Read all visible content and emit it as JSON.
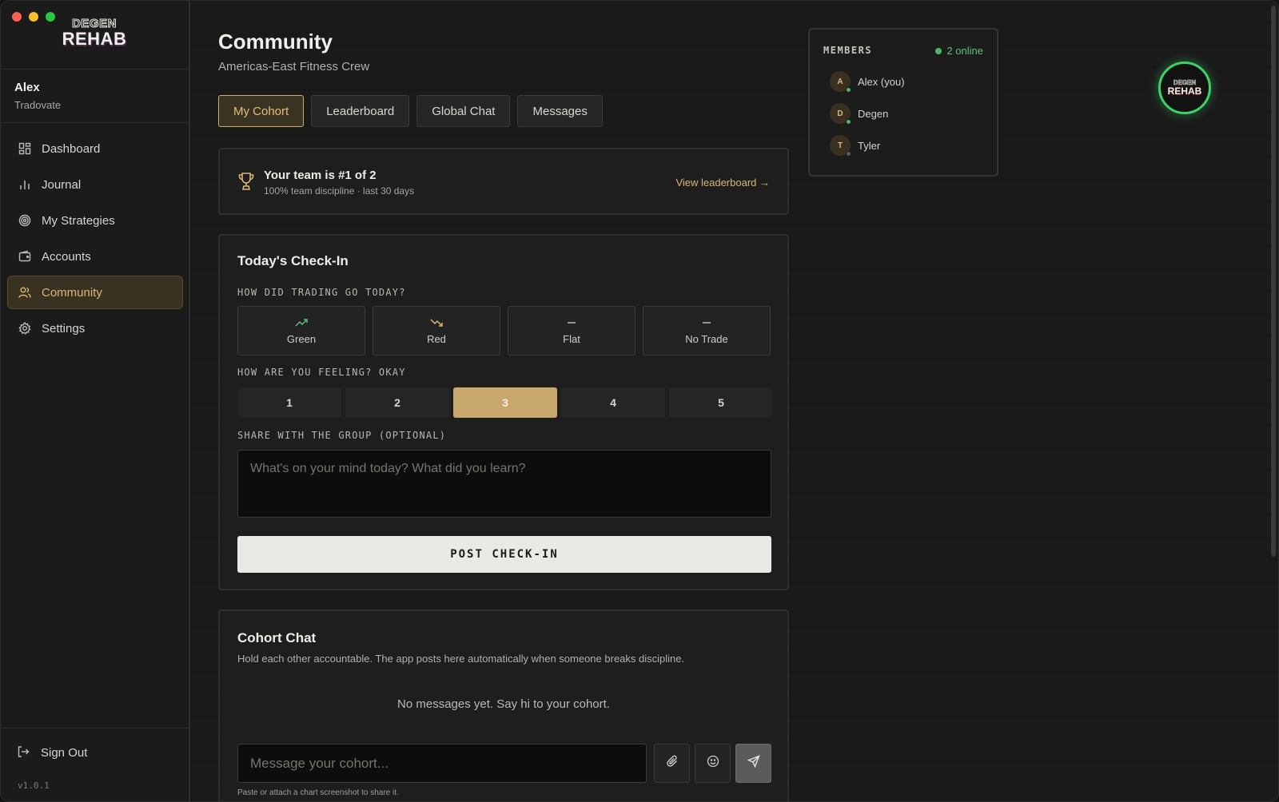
{
  "window": {
    "title": "Degen Rehab"
  },
  "brand": {
    "logo_line1": "DEGEN",
    "logo_line2": "REHAB"
  },
  "user": {
    "name": "Alex",
    "broker": "Tradovate"
  },
  "sidebar": {
    "items": [
      {
        "label": "Dashboard",
        "icon": "dashboard-icon",
        "active": false
      },
      {
        "label": "Journal",
        "icon": "bar-chart-icon",
        "active": false
      },
      {
        "label": "My Strategies",
        "icon": "target-icon",
        "active": false
      },
      {
        "label": "Accounts",
        "icon": "wallet-icon",
        "active": false
      },
      {
        "label": "Community",
        "icon": "users-icon",
        "active": true
      },
      {
        "label": "Settings",
        "icon": "gear-icon",
        "active": false
      }
    ],
    "sign_out": "Sign Out",
    "version": "v1.0.1"
  },
  "page": {
    "title": "Community",
    "subtitle": "Americas-East Fitness Crew"
  },
  "tabs": [
    {
      "label": "My Cohort",
      "active": true
    },
    {
      "label": "Leaderboard",
      "active": false
    },
    {
      "label": "Global Chat",
      "active": false
    },
    {
      "label": "Messages",
      "active": false
    }
  ],
  "banner": {
    "title": "Your team is #1 of 2",
    "subtitle": "100% team discipline · last 30 days",
    "link": "View leaderboard →"
  },
  "checkin": {
    "title": "Today's Check-In",
    "trading_label": "HOW DID TRADING GO TODAY?",
    "outcomes": [
      {
        "label": "Green",
        "icon": "trending-up-icon",
        "color": "#5fbf79"
      },
      {
        "label": "Red",
        "icon": "trending-down-icon",
        "color": "#d9b774"
      },
      {
        "label": "Flat",
        "icon": "minus-icon",
        "color": "#bdbab3"
      },
      {
        "label": "No Trade",
        "icon": "minus-icon",
        "color": "#bdbab3"
      }
    ],
    "feeling_label": "HOW ARE YOU FEELING? OKAY",
    "mood_options": [
      "1",
      "2",
      "3",
      "4",
      "5"
    ],
    "mood_selected": "3",
    "share_label": "SHARE WITH THE GROUP (OPTIONAL)",
    "share_placeholder": "What's on your mind today? What did you learn?",
    "share_value": "",
    "post_button": "POST CHECK-IN"
  },
  "chat": {
    "title": "Cohort Chat",
    "description": "Hold each other accountable. The app posts here automatically when someone breaks discipline.",
    "empty_text": "No messages yet. Say hi to your cohort.",
    "input_placeholder": "Message your cohort...",
    "input_value": "",
    "hint": "Paste or attach a chart screenshot to share it."
  },
  "members": {
    "heading": "MEMBERS",
    "online_text": "2 online",
    "list": [
      {
        "initial": "A",
        "name": "Alex (you)",
        "online": true
      },
      {
        "initial": "D",
        "name": "Degen",
        "online": true
      },
      {
        "initial": "T",
        "name": "Tyler",
        "online": false
      }
    ]
  },
  "floating_badge": {
    "line1": "DEGEN",
    "line2": "REHAB"
  },
  "colors": {
    "accent": "#cfac6b",
    "online": "#4fb56a",
    "background": "#1a1a1a"
  }
}
